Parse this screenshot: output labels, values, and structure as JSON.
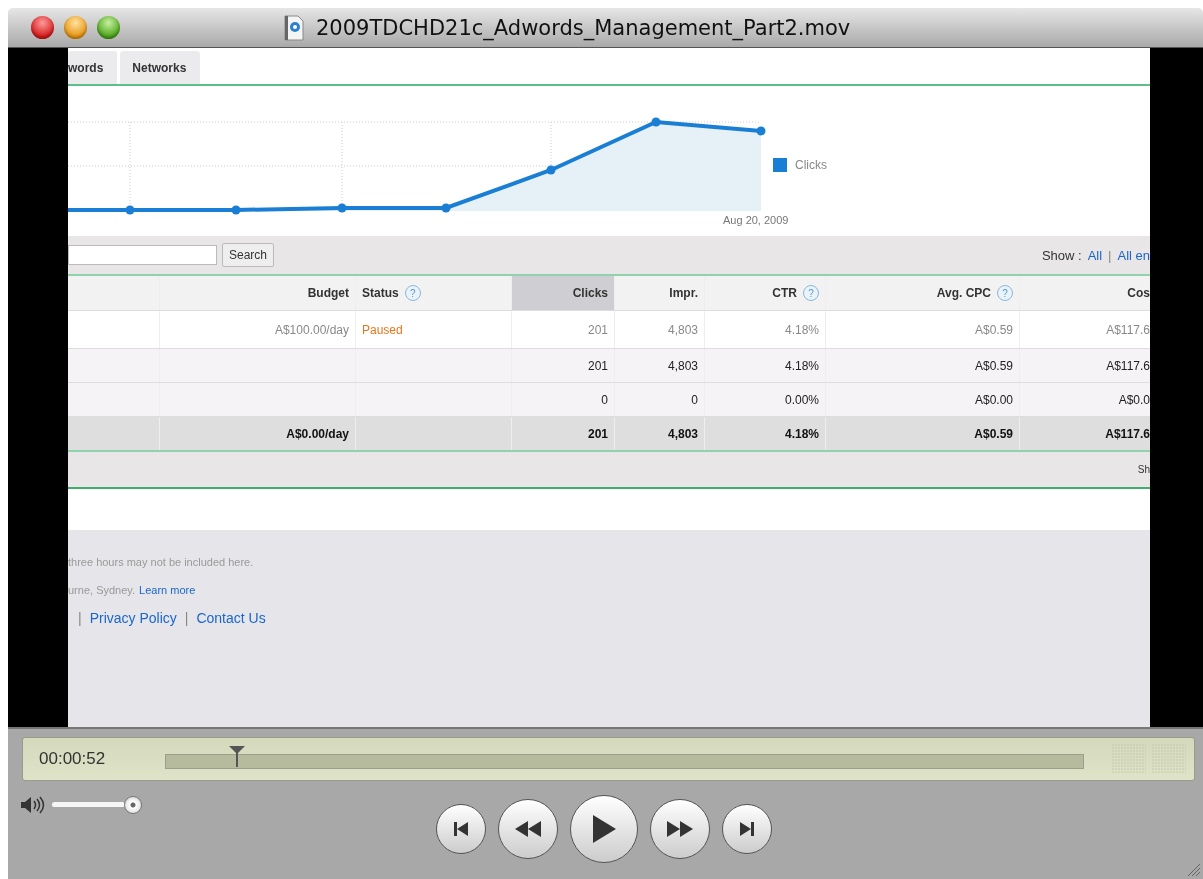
{
  "window": {
    "title": "2009TDCHD21c_Adwords_Management_Part2.mov"
  },
  "page": {
    "tabs": [
      {
        "label": "words",
        "selected": false
      },
      {
        "label": "Networks",
        "selected": false
      }
    ],
    "chart": {
      "legend": "Clicks",
      "x_label": "Aug 20, 2009"
    },
    "search": {
      "button": "Search"
    },
    "show": [
      {
        "kind": "label",
        "text": "Show :"
      },
      {
        "kind": "link",
        "text": "All"
      },
      {
        "kind": "separator",
        "text": "|"
      },
      {
        "kind": "link",
        "text": "All en"
      }
    ],
    "table": {
      "columns": [
        {
          "kind": "blank",
          "sorted": false
        },
        {
          "kind": "number",
          "label": "Budget",
          "sorted": false
        },
        {
          "kind": "status",
          "label": "Status",
          "help": "?",
          "sorted": false
        },
        {
          "kind": "number",
          "label": "Clicks",
          "sorted": true
        },
        {
          "kind": "number",
          "label": "Impr.",
          "sorted": false
        },
        {
          "kind": "number",
          "label": "CTR",
          "help": "?",
          "sorted": false
        },
        {
          "kind": "number",
          "label": "Avg. CPC",
          "help": "?",
          "sorted": false
        },
        {
          "kind": "number",
          "label": "Cos",
          "sorted": false
        }
      ],
      "rows": [
        {
          "kind": "campaign",
          "cells": [
            null,
            "A$100.00/day",
            "Paused",
            "201",
            "4,803",
            "4.18%",
            "A$0.59",
            "A$117.6"
          ]
        },
        {
          "kind": "summary",
          "cells": [
            null,
            null,
            null,
            "201",
            "4,803",
            "4.18%",
            "A$0.59",
            "A$117.6"
          ]
        },
        {
          "kind": "summary",
          "cells": [
            null,
            null,
            null,
            "0",
            "0",
            "0.00%",
            "A$0.00",
            "A$0.0"
          ]
        },
        {
          "kind": "total",
          "cells": [
            null,
            "A$0.00/day",
            null,
            "201",
            "4,803",
            "4.18%",
            "A$0.59",
            "A$117.6"
          ]
        }
      ]
    },
    "pager": "Sh",
    "footer": {
      "note": "three hours may not be included here.",
      "timezone": {
        "text": "urne, Sydney.",
        "link": "Learn more"
      },
      "links": [
        {
          "kind": "separator",
          "text": "|"
        },
        {
          "kind": "link",
          "text": "Privacy Policy"
        },
        {
          "kind": "separator",
          "text": "|"
        },
        {
          "kind": "link",
          "text": "Contact Us"
        }
      ]
    }
  },
  "player": {
    "time": "00:00:52",
    "position": {
      "level": 0.078
    },
    "volume": {
      "level": 0.9
    }
  }
}
